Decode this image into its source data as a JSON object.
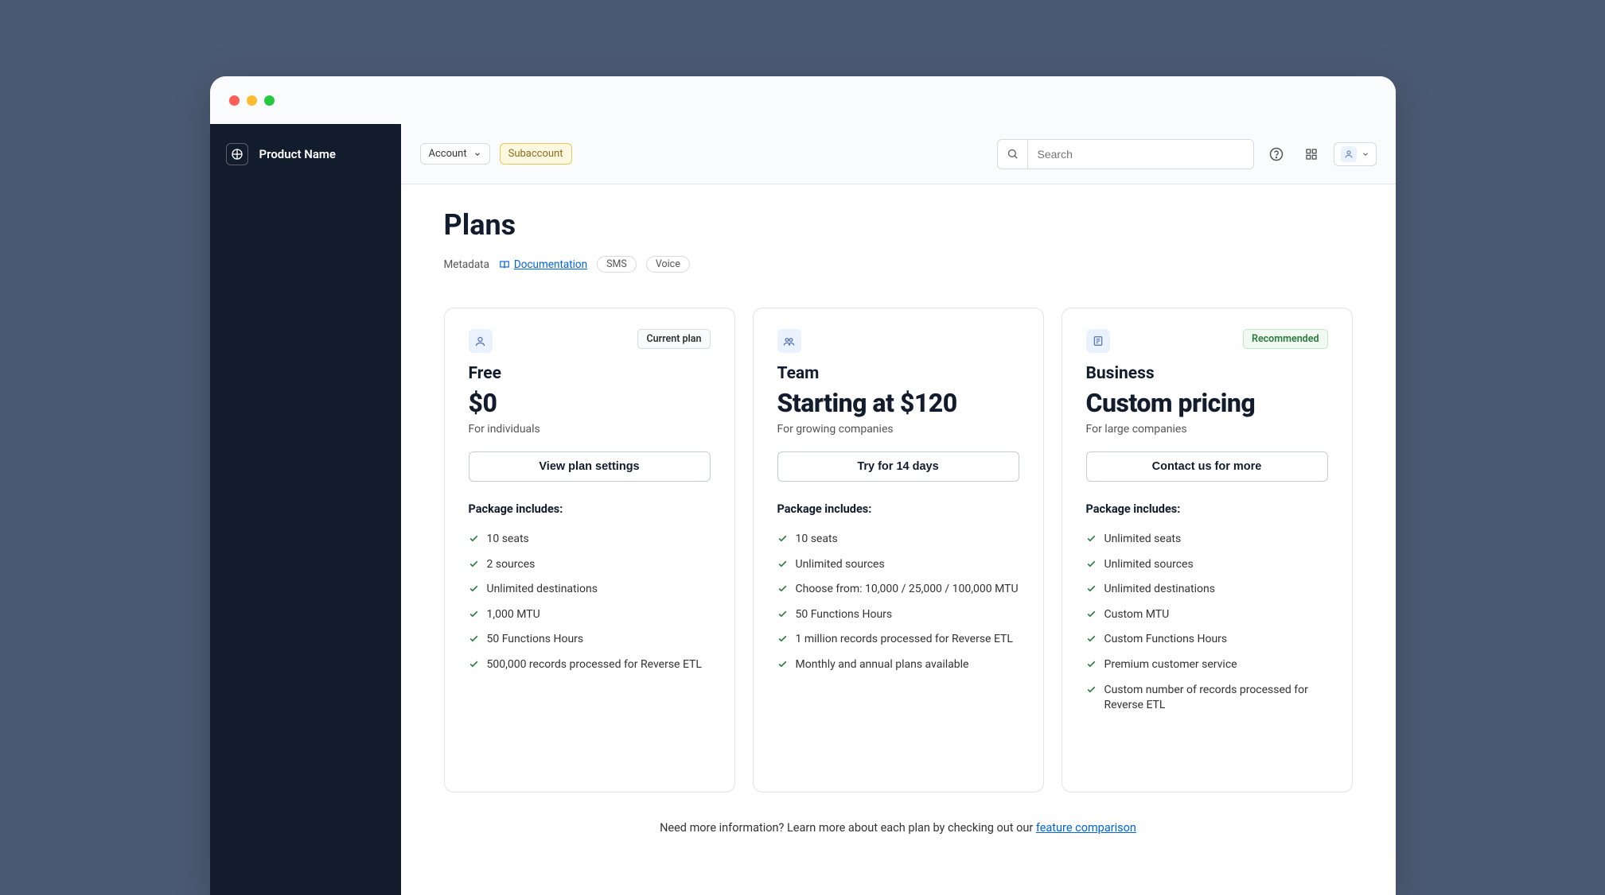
{
  "brand": {
    "name": "Product Name"
  },
  "topbar": {
    "account_label": "Account",
    "subaccount_label": "Subaccount",
    "search_placeholder": "Search"
  },
  "page": {
    "title": "Plans",
    "meta": {
      "metadata_label": "Metadata",
      "documentation_label": "Documentation",
      "sms_label": "SMS",
      "voice_label": "Voice"
    }
  },
  "plans": [
    {
      "badge": "Current plan",
      "badge_style": "neutral",
      "name": "Free",
      "price": "$0",
      "sub": "For individuals",
      "cta": "View plan settings",
      "includes_title": "Package includes:",
      "features": [
        "10 seats",
        "2 sources",
        "Unlimited destinations",
        "1,000 MTU",
        "50 Functions Hours",
        "500,000 records processed for Reverse ETL"
      ]
    },
    {
      "badge": "",
      "badge_style": "",
      "name": "Team",
      "price": "Starting at $120",
      "sub": "For growing companies",
      "cta": "Try for 14 days",
      "includes_title": "Package includes:",
      "features": [
        "10 seats",
        "Unlimited sources",
        "Choose from: 10,000 / 25,000 / 100,000 MTU",
        "50 Functions Hours",
        "1 million records processed for Reverse ETL",
        "Monthly and annual plans available"
      ]
    },
    {
      "badge": "Recommended",
      "badge_style": "green",
      "name": "Business",
      "price": "Custom pricing",
      "sub": "For large companies",
      "cta": "Contact us for more",
      "includes_title": "Package includes:",
      "features": [
        "Unlimited seats",
        "Unlimited sources",
        "Unlimited destinations",
        "Custom MTU",
        "Custom Functions Hours",
        "Premium customer service",
        "Custom number of records processed for Reverse ETL"
      ]
    }
  ],
  "footer": {
    "lead": "Need more information? Learn more about each plan by checking out our ",
    "link_label": "feature comparison"
  }
}
